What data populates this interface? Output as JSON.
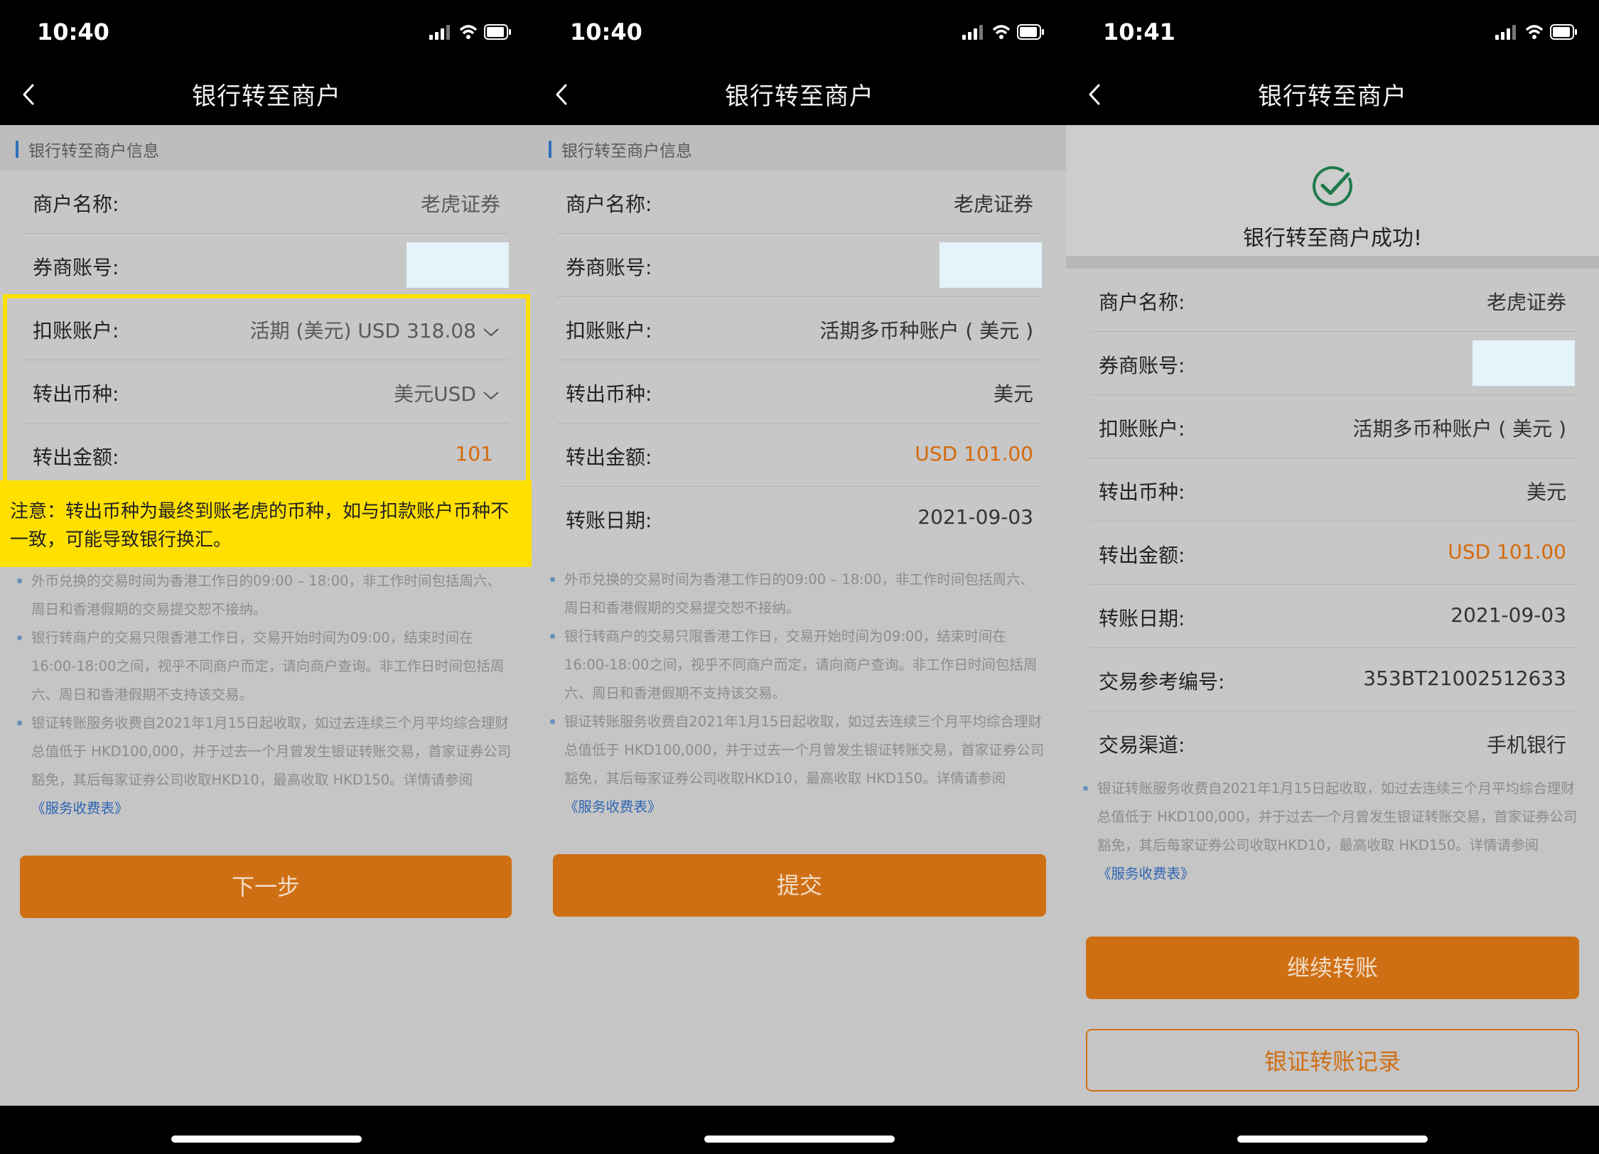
{
  "panels": [
    {
      "time": "10:40",
      "title": "银行转至商户",
      "section_title": "银行转至商户信息",
      "rows": [
        {
          "label": "商户名称:",
          "value": "老虎证券"
        },
        {
          "label": "券商账号:",
          "value": ""
        },
        {
          "label": "扣账账户:",
          "value": "活期 (美元) USD 318.08"
        },
        {
          "label": "转出币种:",
          "value": "美元USD"
        },
        {
          "label": "转出金额:",
          "value": "101"
        }
      ],
      "callout": "注意：转出币种为最终到账老虎的币种，如与扣款账户币种不一致，可能导致银行换汇。",
      "notes": [
        "外币兑换的交易时间为香港工作日的09:00 – 18:00，非工作时间包括周六、周日和香港假期的交易提交恕不接纳。",
        "银行转商户的交易只限香港工作日，交易开始时间为09:00，结束时间在16:00-18:00之间，视乎不同商户而定，请向商户查询。非工作日时间包括周六、周日和香港假期不支持该交易。",
        "银证转账服务收费自2021年1月15日起收取，如过去连续三个月平均综合理财总值低于 HKD100,000，并于过去一个月曾发生银证转账交易，首家证券公司豁免，其后每家证券公司收取HKD10，最高收取 HKD150。详情请参阅"
      ],
      "fee_link": "《服务收费表》",
      "button": "下一步"
    },
    {
      "time": "10:40",
      "title": "银行转至商户",
      "section_title": "银行转至商户信息",
      "rows": [
        {
          "label": "商户名称:",
          "value": "老虎证券"
        },
        {
          "label": "券商账号:",
          "value": ""
        },
        {
          "label": "扣账账户:",
          "value": "活期多币种账户 ( 美元 )"
        },
        {
          "label": "转出币种:",
          "value": "美元"
        },
        {
          "label": "转出金额:",
          "value": "USD 101.00"
        },
        {
          "label": "转账日期:",
          "value": "2021-09-03"
        }
      ],
      "notes": [
        "外币兑换的交易时间为香港工作日的09:00 – 18:00，非工作时间包括周六、周日和香港假期的交易提交恕不接纳。",
        "银行转商户的交易只限香港工作日，交易开始时间为09:00，结束时间在16:00-18:00之间，视乎不同商户而定，请向商户查询。非工作日时间包括周六、周日和香港假期不支持该交易。",
        "银证转账服务收费自2021年1月15日起收取，如过去连续三个月平均综合理财总值低于 HKD100,000，并于过去一个月曾发生银证转账交易，首家证券公司豁免，其后每家证券公司收取HKD10，最高收取 HKD150。详情请参阅"
      ],
      "fee_link": "《服务收费表》",
      "button": "提交"
    },
    {
      "time": "10:41",
      "title": "银行转至商户",
      "success_text": "银行转至商户成功!",
      "rows": [
        {
          "label": "商户名称:",
          "value": "老虎证券"
        },
        {
          "label": "券商账号:",
          "value": ""
        },
        {
          "label": "扣账账户:",
          "value": "活期多币种账户 ( 美元 )"
        },
        {
          "label": "转出币种:",
          "value": "美元"
        },
        {
          "label": "转出金额:",
          "value": "USD 101.00"
        },
        {
          "label": "转账日期:",
          "value": "2021-09-03"
        },
        {
          "label": "交易参考编号:",
          "value": "353BT21002512633"
        },
        {
          "label": "交易渠道:",
          "value": "手机银行"
        }
      ],
      "notes": [
        "银证转账服务收费自2021年1月15日起收取，如过去连续三个月平均综合理财总值低于 HKD100,000，并于过去一个月曾发生银证转账交易，首家证券公司豁免，其后每家证券公司收取HKD10，最高收取 HKD150。详情请参阅"
      ],
      "fee_link": "《服务收费表》",
      "button_primary": "继续转账",
      "button_secondary": "银证转账记录"
    }
  ],
  "colors": {
    "accent_orange": "#cf6f14",
    "amount_orange": "#d46a0c",
    "highlight_yellow": "#ffe000",
    "link_blue": "#2d64b4"
  }
}
